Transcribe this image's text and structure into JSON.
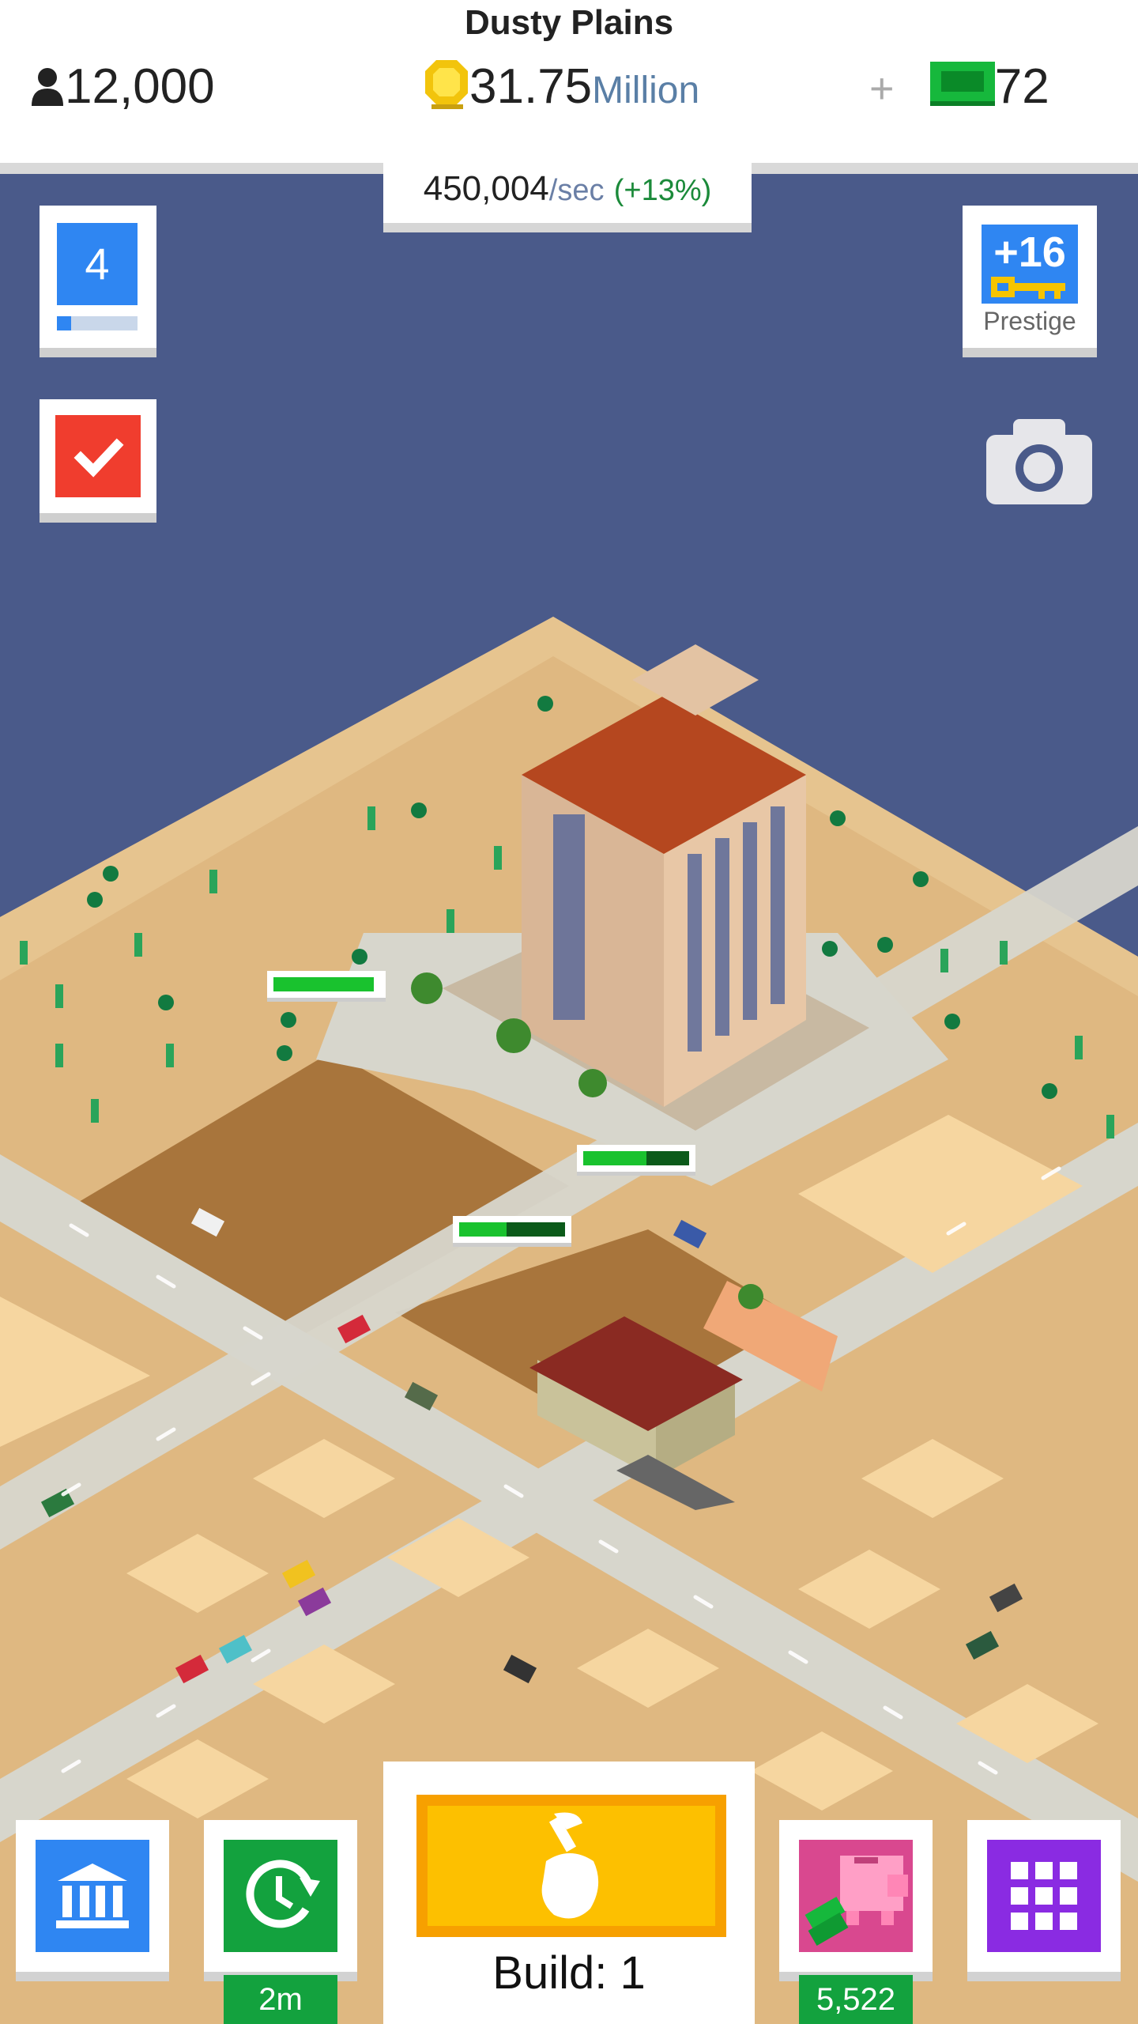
{
  "header": {
    "location": "Dusty Plains",
    "population": "12,000",
    "coins": "31.75",
    "coins_unit": "Million",
    "plus": "+",
    "cash": "72"
  },
  "income": {
    "value": "450,004",
    "unit": "/sec",
    "bonus": "(+13%)"
  },
  "level": {
    "value": "4",
    "progress": 0.18
  },
  "prestige": {
    "keys": "+16",
    "label": "Prestige"
  },
  "bottom": {
    "timer_badge": "2m",
    "build_label": "Build: 1",
    "piggy_badge": "5,522"
  },
  "progress_bars": [
    {
      "fill": 0.95
    },
    {
      "fill": 0.6
    },
    {
      "fill": 0.45
    }
  ],
  "colors": {
    "sky": "#4a5a8a",
    "sand": "#e0bc85",
    "road": "#d5d5c8",
    "accent_blue": "#2f86f2",
    "accent_green": "#13a23e",
    "accent_red": "#f03d2e",
    "build_yellow": "#fdc000",
    "piggy_pink": "#d9488f",
    "grid_purple": "#8a2be2"
  },
  "icons": [
    "person-icon",
    "coin-icon",
    "cash-icon",
    "check-icon",
    "key-icon",
    "camera-icon",
    "bank-icon",
    "clock-refresh-icon",
    "hammer-hand-icon",
    "piggy-bank-icon",
    "grid-menu-icon"
  ]
}
